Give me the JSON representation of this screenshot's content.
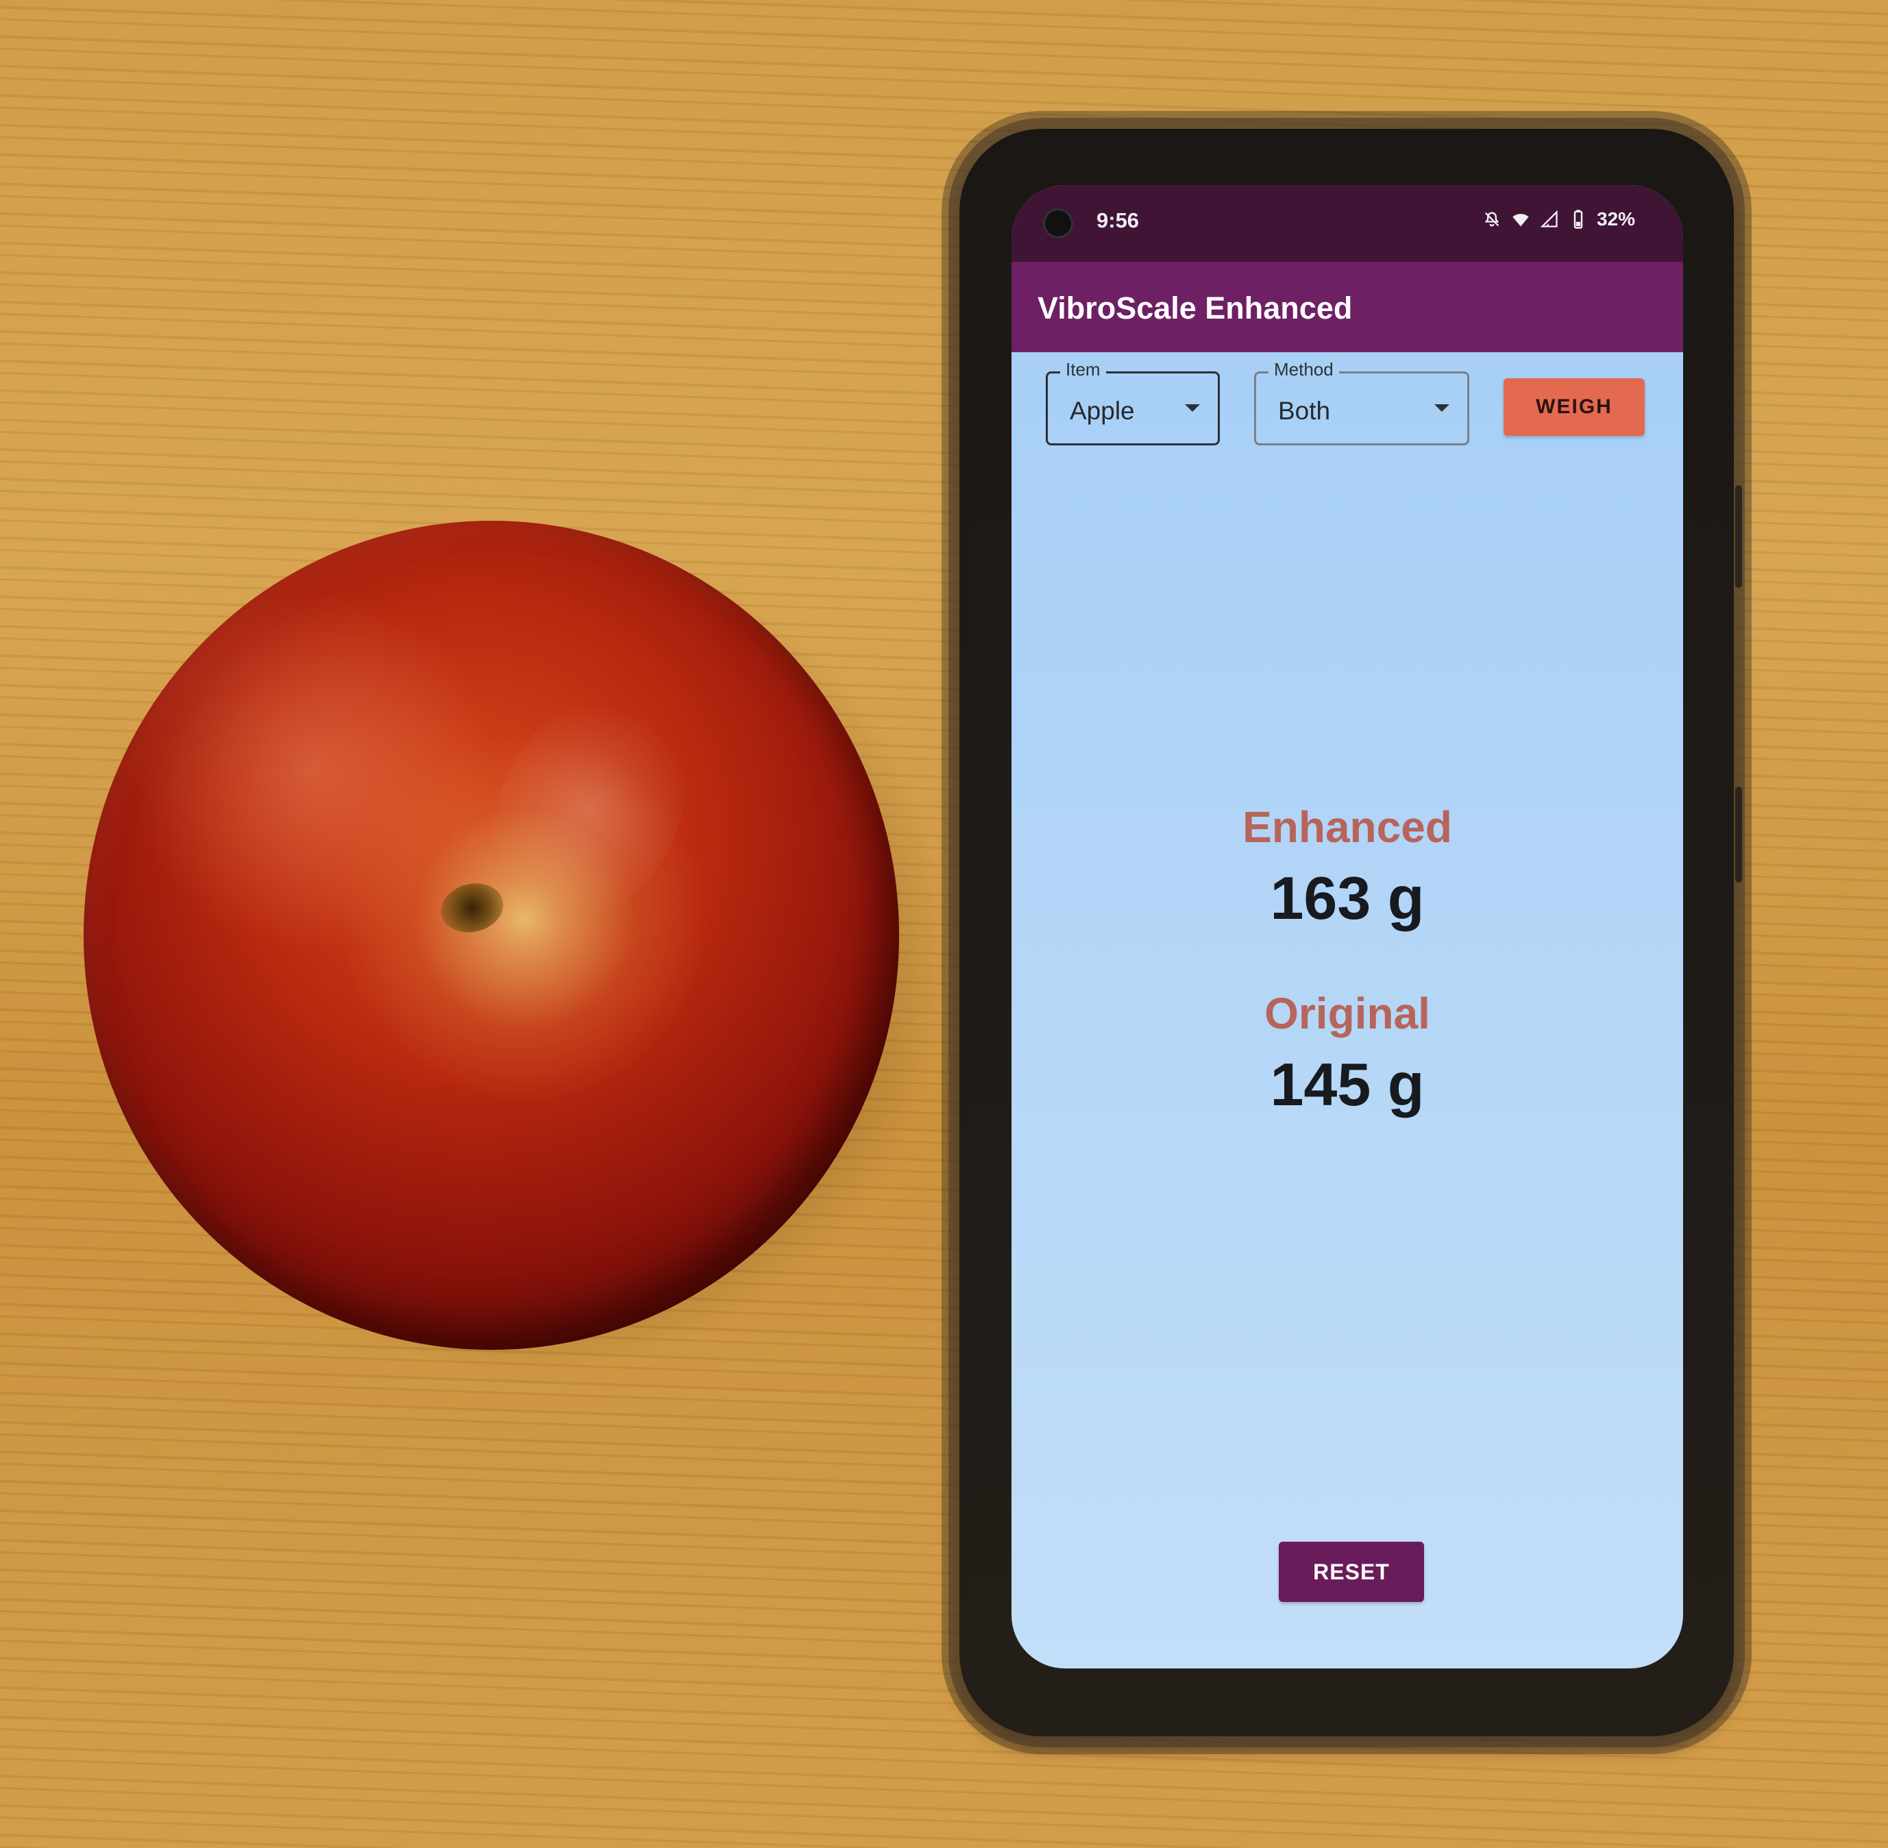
{
  "status_bar": {
    "time": "9:56",
    "battery": "32%",
    "icons": [
      "bell-off-icon",
      "wifi-icon",
      "signal-icon",
      "battery-icon"
    ]
  },
  "app_bar": {
    "title": "VibroScale Enhanced"
  },
  "controls": {
    "item": {
      "label": "Item",
      "value": "Apple"
    },
    "method": {
      "label": "Method",
      "value": "Both"
    },
    "weigh_button": "WEIGH"
  },
  "results": {
    "enhanced": {
      "label": "Enhanced",
      "value": "163 g"
    },
    "original": {
      "label": "Original",
      "value": "145 g"
    }
  },
  "footer": {
    "reset_button": "RESET"
  },
  "colors": {
    "status_bar": "#3f1435",
    "app_bar": "#6d2063",
    "screen_background": "#a4cdf6",
    "weigh_button": "#e36a4f",
    "reset_button": "#6a1b59",
    "result_label": "#b7645a",
    "result_value": "#171a1e"
  }
}
